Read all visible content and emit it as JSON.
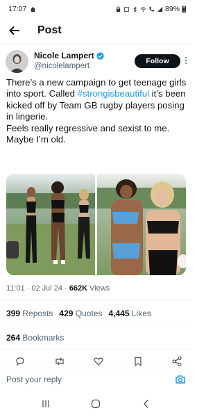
{
  "status_bar": {
    "time": "17:07",
    "battery": "89%"
  },
  "header": {
    "title": "Post"
  },
  "author": {
    "name": "Nicole Lampert",
    "handle": "@nicolelampert",
    "follow_label": "Follow",
    "verified": true
  },
  "tweet": {
    "line1": "There’s a new campaign to get teenage girls into sport. Called ",
    "hashtag": "#strongisbeautiful",
    "line2": " it’s been kicked off by Team GB rugby players posing in lingerie.",
    "line3": "Feels really regressive and sexist to me. Maybe I’m old."
  },
  "meta": {
    "time": "11:01",
    "date": "02 Jul 24",
    "views_count": "662K",
    "views_label": "Views"
  },
  "stats": {
    "reposts_count": "399",
    "reposts_label": "Reposts",
    "quotes_count": "429",
    "quotes_label": "Quotes",
    "likes_count": "4,445",
    "likes_label": "Likes",
    "bookmarks_count": "264",
    "bookmarks_label": "Bookmarks"
  },
  "reply": {
    "placeholder": "Post your reply"
  },
  "icons": {
    "back": "arrow-left-icon",
    "verified": "verified-badge-icon",
    "more": "more-vertical-icon",
    "reply": "reply-icon",
    "repost": "repost-icon",
    "like": "heart-icon",
    "bookmark": "bookmark-icon",
    "share": "share-icon",
    "camera": "camera-icon"
  },
  "colors": {
    "accent": "#1d9bf0",
    "text": "#0f1419",
    "muted": "#536471",
    "follow_bg": "#0f1419"
  }
}
